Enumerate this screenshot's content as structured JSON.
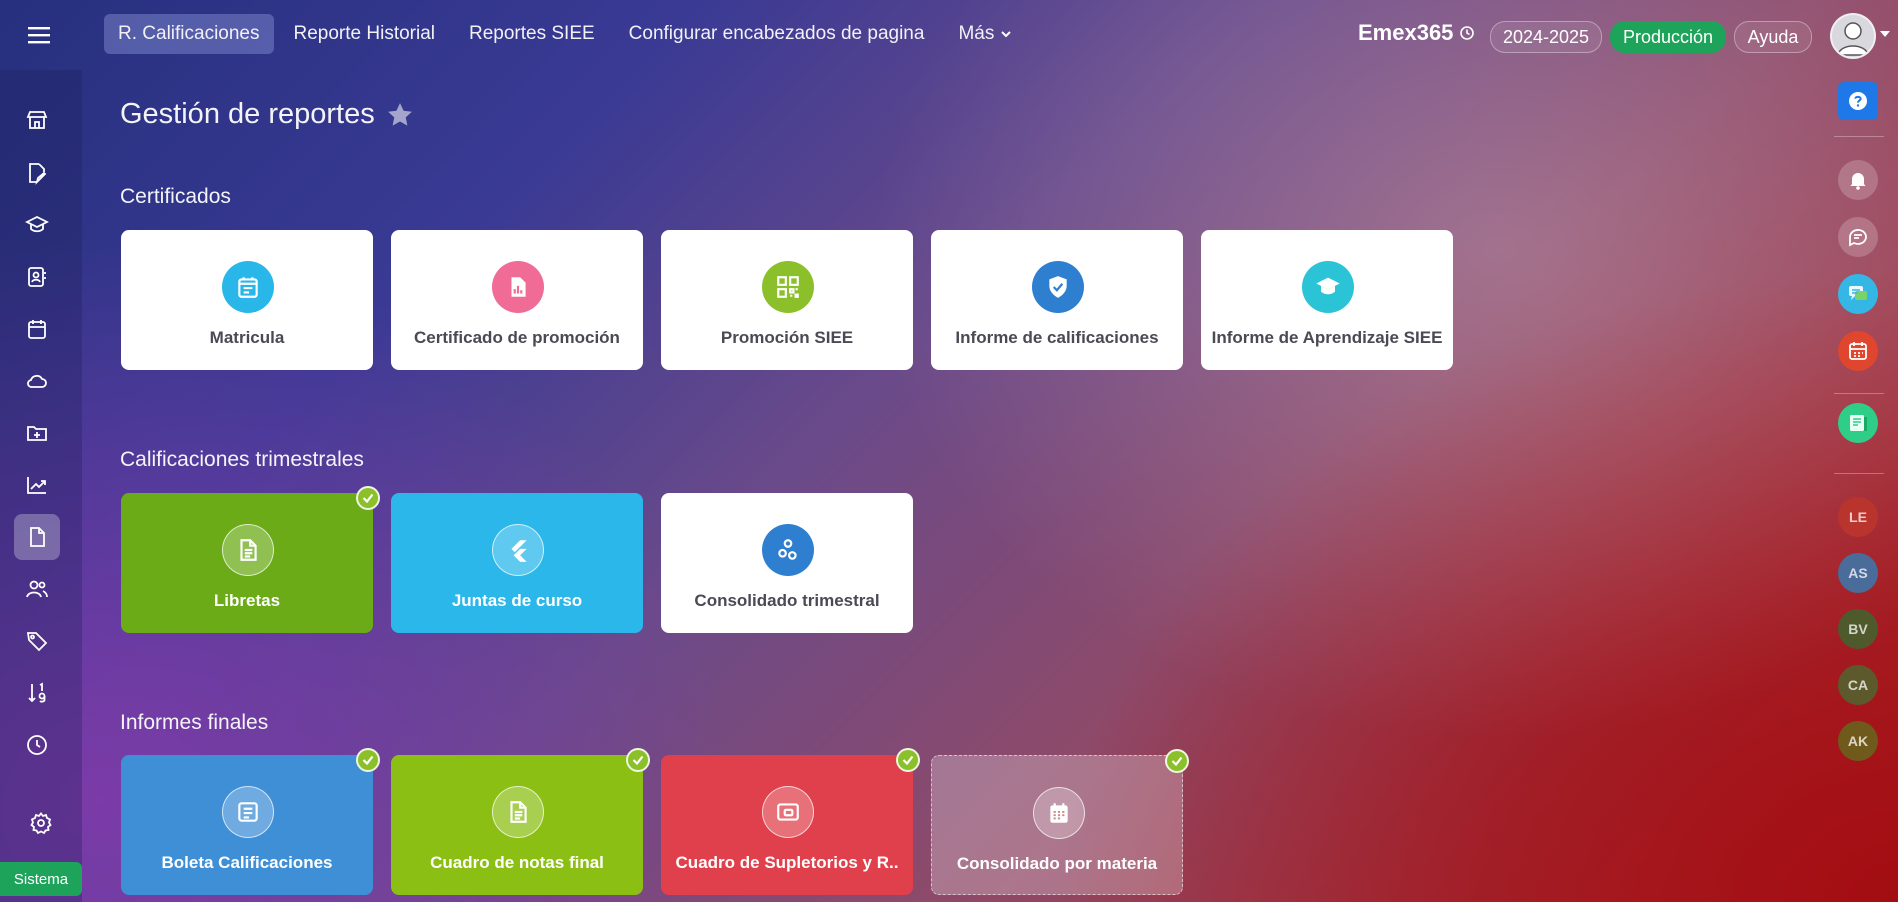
{
  "header": {
    "nav": [
      {
        "label": "R. Calificaciones",
        "active": true
      },
      {
        "label": "Reporte Historial"
      },
      {
        "label": "Reportes SIEE"
      },
      {
        "label": "Configurar encabezados de pagina"
      },
      {
        "label": "Más"
      }
    ],
    "brand": "Emex365",
    "year": "2024-2025",
    "environment": "Producción",
    "help": "Ayuda"
  },
  "page_title": "Gestión de reportes",
  "sections": {
    "certificados": {
      "title": "Certificados",
      "cards": [
        {
          "label": "Matricula",
          "icon": "calendar-form-icon",
          "color": "#29b6e8"
        },
        {
          "label": "Certificado de promoción",
          "icon": "chart-document-icon",
          "color": "#f06c96"
        },
        {
          "label": "Promoción SIEE",
          "icon": "qr-code-icon",
          "color": "#8cc02a"
        },
        {
          "label": "Informe de calificaciones",
          "icon": "shield-check-icon",
          "color": "#2f7fd0"
        },
        {
          "label": "Informe de Aprendizaje SIEE",
          "icon": "graduation-cap-icon",
          "color": "#2bc4d6"
        }
      ]
    },
    "trimestrales": {
      "title": "Calificaciones trimestrales",
      "cards": [
        {
          "label": "Libretas",
          "icon": "document-icon",
          "color": "#6aab17",
          "checked": true
        },
        {
          "label": "Juntas de curso",
          "icon": "flutter-icon",
          "color": "#2bb7ea"
        },
        {
          "label": "Consolidado trimestral",
          "icon": "molecule-icon",
          "color": "#2f7fd0"
        }
      ]
    },
    "finales": {
      "title": "Informes finales",
      "cards": [
        {
          "label": "Boleta Calificaciones",
          "icon": "list-document-icon",
          "color": "#3f8fd6",
          "checked": true
        },
        {
          "label": "Cuadro de notas final",
          "icon": "document-icon",
          "color": "#8bbf14",
          "checked": true
        },
        {
          "label": "Cuadro de Supletorios y R..",
          "icon": "card-icon",
          "color": "#e0404c",
          "checked": true
        },
        {
          "label": "Consolidado por materia",
          "icon": "calendar-icon",
          "color": "transparent",
          "checked": true
        }
      ]
    }
  },
  "right_sidebar": {
    "initials": [
      {
        "text": "LE",
        "color": "#b8342c"
      },
      {
        "text": "AS",
        "color": "#4a6c9a"
      },
      {
        "text": "BV",
        "color": "#4f5a2c"
      },
      {
        "text": "CA",
        "color": "#5c5a2c"
      },
      {
        "text": "AK",
        "color": "#6f5a1c"
      }
    ]
  },
  "footer": {
    "sistema": "Sistema"
  }
}
